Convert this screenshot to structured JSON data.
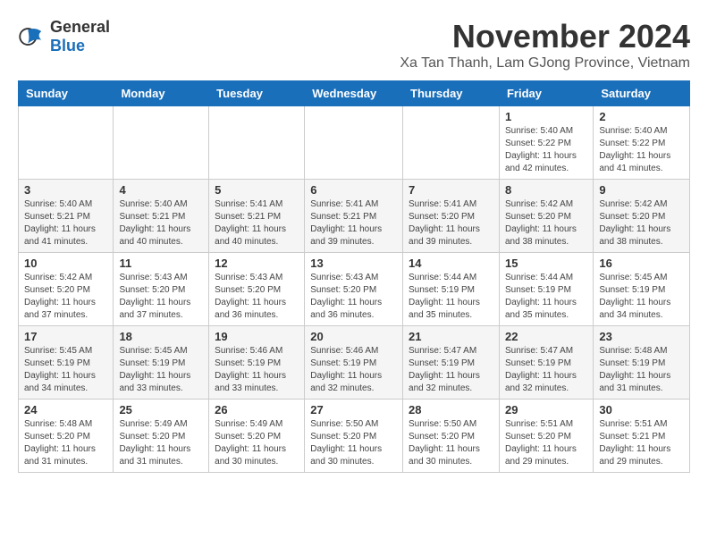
{
  "header": {
    "logo_general": "General",
    "logo_blue": "Blue",
    "month_title": "November 2024",
    "subtitle": "Xa Tan Thanh, Lam GJong Province, Vietnam"
  },
  "calendar": {
    "days_of_week": [
      "Sunday",
      "Monday",
      "Tuesday",
      "Wednesday",
      "Thursday",
      "Friday",
      "Saturday"
    ],
    "weeks": [
      [
        {
          "day": "",
          "info": ""
        },
        {
          "day": "",
          "info": ""
        },
        {
          "day": "",
          "info": ""
        },
        {
          "day": "",
          "info": ""
        },
        {
          "day": "",
          "info": ""
        },
        {
          "day": "1",
          "info": "Sunrise: 5:40 AM\nSunset: 5:22 PM\nDaylight: 11 hours and 42 minutes."
        },
        {
          "day": "2",
          "info": "Sunrise: 5:40 AM\nSunset: 5:22 PM\nDaylight: 11 hours and 41 minutes."
        }
      ],
      [
        {
          "day": "3",
          "info": "Sunrise: 5:40 AM\nSunset: 5:21 PM\nDaylight: 11 hours and 41 minutes."
        },
        {
          "day": "4",
          "info": "Sunrise: 5:40 AM\nSunset: 5:21 PM\nDaylight: 11 hours and 40 minutes."
        },
        {
          "day": "5",
          "info": "Sunrise: 5:41 AM\nSunset: 5:21 PM\nDaylight: 11 hours and 40 minutes."
        },
        {
          "day": "6",
          "info": "Sunrise: 5:41 AM\nSunset: 5:21 PM\nDaylight: 11 hours and 39 minutes."
        },
        {
          "day": "7",
          "info": "Sunrise: 5:41 AM\nSunset: 5:20 PM\nDaylight: 11 hours and 39 minutes."
        },
        {
          "day": "8",
          "info": "Sunrise: 5:42 AM\nSunset: 5:20 PM\nDaylight: 11 hours and 38 minutes."
        },
        {
          "day": "9",
          "info": "Sunrise: 5:42 AM\nSunset: 5:20 PM\nDaylight: 11 hours and 38 minutes."
        }
      ],
      [
        {
          "day": "10",
          "info": "Sunrise: 5:42 AM\nSunset: 5:20 PM\nDaylight: 11 hours and 37 minutes."
        },
        {
          "day": "11",
          "info": "Sunrise: 5:43 AM\nSunset: 5:20 PM\nDaylight: 11 hours and 37 minutes."
        },
        {
          "day": "12",
          "info": "Sunrise: 5:43 AM\nSunset: 5:20 PM\nDaylight: 11 hours and 36 minutes."
        },
        {
          "day": "13",
          "info": "Sunrise: 5:43 AM\nSunset: 5:20 PM\nDaylight: 11 hours and 36 minutes."
        },
        {
          "day": "14",
          "info": "Sunrise: 5:44 AM\nSunset: 5:19 PM\nDaylight: 11 hours and 35 minutes."
        },
        {
          "day": "15",
          "info": "Sunrise: 5:44 AM\nSunset: 5:19 PM\nDaylight: 11 hours and 35 minutes."
        },
        {
          "day": "16",
          "info": "Sunrise: 5:45 AM\nSunset: 5:19 PM\nDaylight: 11 hours and 34 minutes."
        }
      ],
      [
        {
          "day": "17",
          "info": "Sunrise: 5:45 AM\nSunset: 5:19 PM\nDaylight: 11 hours and 34 minutes."
        },
        {
          "day": "18",
          "info": "Sunrise: 5:45 AM\nSunset: 5:19 PM\nDaylight: 11 hours and 33 minutes."
        },
        {
          "day": "19",
          "info": "Sunrise: 5:46 AM\nSunset: 5:19 PM\nDaylight: 11 hours and 33 minutes."
        },
        {
          "day": "20",
          "info": "Sunrise: 5:46 AM\nSunset: 5:19 PM\nDaylight: 11 hours and 32 minutes."
        },
        {
          "day": "21",
          "info": "Sunrise: 5:47 AM\nSunset: 5:19 PM\nDaylight: 11 hours and 32 minutes."
        },
        {
          "day": "22",
          "info": "Sunrise: 5:47 AM\nSunset: 5:19 PM\nDaylight: 11 hours and 32 minutes."
        },
        {
          "day": "23",
          "info": "Sunrise: 5:48 AM\nSunset: 5:19 PM\nDaylight: 11 hours and 31 minutes."
        }
      ],
      [
        {
          "day": "24",
          "info": "Sunrise: 5:48 AM\nSunset: 5:20 PM\nDaylight: 11 hours and 31 minutes."
        },
        {
          "day": "25",
          "info": "Sunrise: 5:49 AM\nSunset: 5:20 PM\nDaylight: 11 hours and 31 minutes."
        },
        {
          "day": "26",
          "info": "Sunrise: 5:49 AM\nSunset: 5:20 PM\nDaylight: 11 hours and 30 minutes."
        },
        {
          "day": "27",
          "info": "Sunrise: 5:50 AM\nSunset: 5:20 PM\nDaylight: 11 hours and 30 minutes."
        },
        {
          "day": "28",
          "info": "Sunrise: 5:50 AM\nSunset: 5:20 PM\nDaylight: 11 hours and 30 minutes."
        },
        {
          "day": "29",
          "info": "Sunrise: 5:51 AM\nSunset: 5:20 PM\nDaylight: 11 hours and 29 minutes."
        },
        {
          "day": "30",
          "info": "Sunrise: 5:51 AM\nSunset: 5:21 PM\nDaylight: 11 hours and 29 minutes."
        }
      ]
    ]
  }
}
